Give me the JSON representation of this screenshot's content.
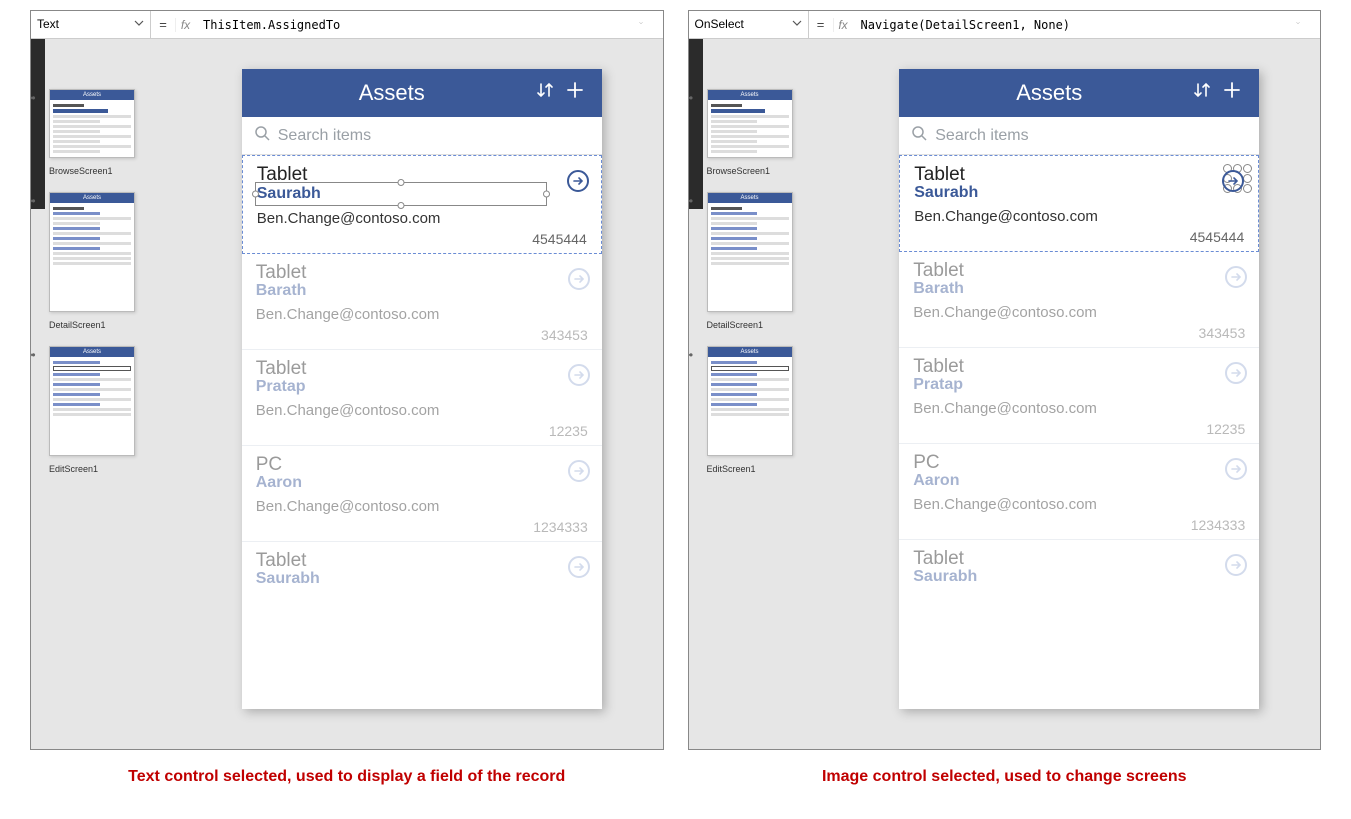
{
  "left": {
    "propertySelector": "Text",
    "formula": "ThisItem.AssignedTo",
    "caption": "Text control selected, used to display a field of the record"
  },
  "right": {
    "propertySelector": "OnSelect",
    "formula": "Navigate(DetailScreen1, None)",
    "caption": "Image control selected, used to change screens"
  },
  "thumbs": [
    {
      "label": "BrowseScreen1"
    },
    {
      "label": "DetailScreen1"
    },
    {
      "label": "EditScreen1"
    }
  ],
  "app": {
    "title": "Assets",
    "searchPlaceholder": "Search items"
  },
  "items": [
    {
      "title": "Tablet",
      "name": "Saurabh",
      "email": "Ben.Change@contoso.com",
      "num": "4545444"
    },
    {
      "title": "Tablet",
      "name": "Barath",
      "email": "Ben.Change@contoso.com",
      "num": "343453"
    },
    {
      "title": "Tablet",
      "name": "Pratap",
      "email": "Ben.Change@contoso.com",
      "num": "12235"
    },
    {
      "title": "PC",
      "name": "Aaron",
      "email": "Ben.Change@contoso.com",
      "num": "1234333"
    },
    {
      "title": "Tablet",
      "name": "Saurabh",
      "email": "",
      "num": ""
    }
  ]
}
